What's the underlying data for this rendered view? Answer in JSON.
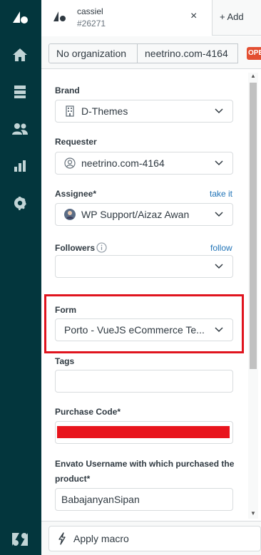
{
  "nav": {
    "items": [
      {
        "icon": "zendesk-logo-icon"
      },
      {
        "icon": "home-icon"
      },
      {
        "icon": "views-icon"
      },
      {
        "icon": "customers-icon"
      },
      {
        "icon": "reporting-icon"
      },
      {
        "icon": "admin-gear-icon"
      }
    ],
    "footer_icon": "zendesk-z-icon"
  },
  "tabbar": {
    "tab_title": "cassiel",
    "tab_id": "#26271",
    "close_symbol": "×",
    "add_label": "+ Add"
  },
  "breadcrumbs": {
    "organization": "No organization",
    "requester": "neetrino.com-4164",
    "status": "OPEN",
    "status_color": "#e34f32"
  },
  "fields": {
    "brand": {
      "label": "Brand",
      "value": "D-Themes"
    },
    "requester": {
      "label": "Requester",
      "value": "neetrino.com-4164"
    },
    "assignee": {
      "label": "Assignee*",
      "link": "take it",
      "value": "WP Support/Aizaz Awan"
    },
    "followers": {
      "label": "Followers",
      "link": "follow",
      "value": ""
    },
    "form": {
      "label": "Form",
      "value": "Porto - VueJS eCommerce Te..."
    },
    "tags": {
      "label": "Tags",
      "value": ""
    },
    "purchase_code": {
      "label": "Purchase Code*",
      "value_redacted": true
    },
    "envato": {
      "label_line1": "Envato Username with which purchased the",
      "label_line2": "product*",
      "value": "BabajanyanSipan"
    }
  },
  "footer": {
    "macro_label": "Apply macro"
  },
  "colors": {
    "sidebar": "#03363d",
    "link": "#1f73b7",
    "highlight": "#e0141e"
  }
}
